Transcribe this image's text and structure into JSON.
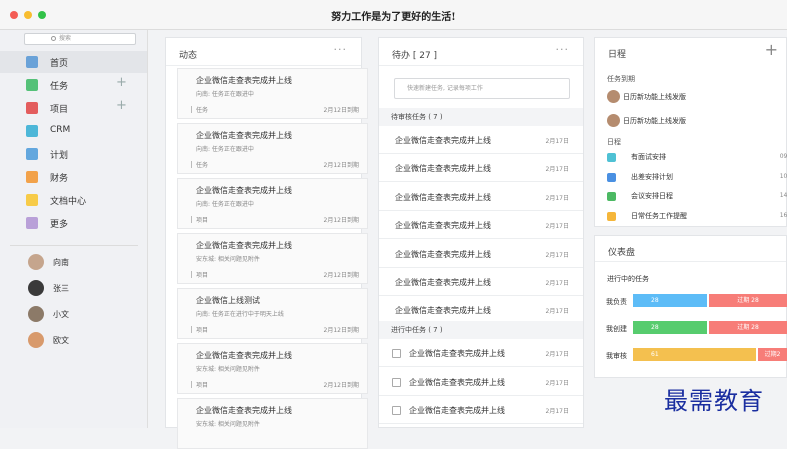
{
  "window": {
    "slogan": "努力工作是为了更好的生活!"
  },
  "colors": {
    "close": "#f45c55",
    "minimize": "#f8bd2f",
    "zoom": "#32c248",
    "done": "#5dbcf7",
    "overdue": "#f77d78",
    "created": "#57cc6e",
    "review": "#f4c04f"
  },
  "sidebar": {
    "search_placeholder": "搜索",
    "nav": [
      {
        "label": "首页",
        "icon": "home-icon",
        "color": "#6aa2d8",
        "plus": ""
      },
      {
        "label": "任务",
        "icon": "task-icon",
        "color": "#55c178",
        "plus": "+"
      },
      {
        "label": "项目",
        "icon": "project-icon",
        "color": "#e35d5d",
        "plus": "+"
      },
      {
        "label": "CRM",
        "icon": "crm-icon",
        "color": "#4db7d8",
        "plus": ""
      },
      {
        "label": "计划",
        "icon": "plan-icon",
        "color": "#63a7de",
        "plus": ""
      },
      {
        "label": "财务",
        "icon": "finance-icon",
        "color": "#f2a24a",
        "plus": ""
      },
      {
        "label": "文档中心",
        "icon": "folder-icon",
        "color": "#f7cb48",
        "plus": ""
      },
      {
        "label": "更多",
        "icon": "grid-icon",
        "color": "#b9a0d8",
        "plus": ""
      }
    ],
    "people": [
      {
        "name": "向南"
      },
      {
        "name": "张三"
      },
      {
        "name": "小文"
      },
      {
        "name": "欧文"
      }
    ]
  },
  "activity": {
    "title": "动态",
    "more": "···",
    "cards": [
      {
        "title": "企业微信走查表完成并上线",
        "sub": "向南: 任务正在跟进中",
        "kind": "任务",
        "date": "2月12日到期"
      },
      {
        "title": "企业微信走查表完成并上线",
        "sub": "向南: 任务正在跟进中",
        "kind": "任务",
        "date": "2月12日到期"
      },
      {
        "title": "企业微信走查表完成并上线",
        "sub": "向南: 任务正在跟进中",
        "kind": "项目",
        "date": "2月12日到期"
      },
      {
        "title": "企业微信走查表完成并上线",
        "sub": "安东城: 相关问题见附件",
        "kind": "项目",
        "date": "2月12日到期"
      },
      {
        "title": "企业微信上线测试",
        "sub": "向南: 任务正在进行中于明天上线",
        "kind": "项目",
        "date": "2月12日到期"
      },
      {
        "title": "企业微信走查表完成并上线",
        "sub": "安东城: 相关问题见附件",
        "kind": "项目",
        "date": "2月12日到期"
      },
      {
        "title": "企业微信走查表完成并上线",
        "sub": "安东城: 相关问题见附件",
        "kind": "",
        "date": ""
      }
    ]
  },
  "todo": {
    "title": "待办 [ 27 ]",
    "more": "···",
    "input_placeholder": "快速新建任务, 记录每项工作",
    "review_section": "待审核任务 ( 7 )",
    "review": [
      {
        "title": "企业微信走查表完成并上线",
        "date": "2月17日"
      },
      {
        "title": "企业微信走查表完成并上线",
        "date": "2月17日"
      },
      {
        "title": "企业微信走查表完成并上线",
        "date": "2月17日"
      },
      {
        "title": "企业微信走查表完成并上线",
        "date": "2月17日"
      },
      {
        "title": "企业微信走查表完成并上线",
        "date": "2月17日"
      },
      {
        "title": "企业微信走查表完成并上线",
        "date": "2月17日"
      },
      {
        "title": "企业微信走查表完成并上线",
        "date": "2月17日"
      }
    ],
    "progress_section": "进行中任务 ( 7 )",
    "progress": [
      {
        "title": "企业微信走查表完成并上线",
        "date": "2月17日"
      },
      {
        "title": "企业微信走查表完成并上线",
        "date": "2月17日"
      },
      {
        "title": "企业微信走查表完成并上线",
        "date": "2月17日"
      }
    ]
  },
  "schedule": {
    "title": "日程",
    "plus": "+",
    "due_label": "任务到期",
    "due": [
      {
        "title": "日历新功能上线发版"
      },
      {
        "title": "日历新功能上线发版"
      }
    ],
    "agenda_label": "日程",
    "agenda": [
      {
        "title": "有面试安排",
        "time": "09:30",
        "icon": "interview-icon",
        "color": "#4fc1d4"
      },
      {
        "title": "出差安排计划",
        "time": "10:30",
        "icon": "trip-icon",
        "color": "#4a90e2"
      },
      {
        "title": "会议安排日程",
        "time": "14:30",
        "icon": "meeting-icon",
        "color": "#4cb963"
      },
      {
        "title": "日常任务工作提醒",
        "time": "16:30",
        "icon": "reminder-icon",
        "color": "#f5b63a"
      }
    ]
  },
  "dashboard": {
    "title": "仪表盘",
    "section": "进行中的任务",
    "rows": [
      {
        "label": "我负责",
        "done": 28,
        "overdue_text": "过期 28",
        "done_frac": 0.48
      },
      {
        "label": "我创建",
        "done": 28,
        "overdue_text": "过期 28",
        "done_frac": 0.48
      },
      {
        "label": "我审核",
        "done": 61,
        "overdue_text": "过期2",
        "done_frac": 0.8
      }
    ]
  },
  "watermark": "最需教育"
}
